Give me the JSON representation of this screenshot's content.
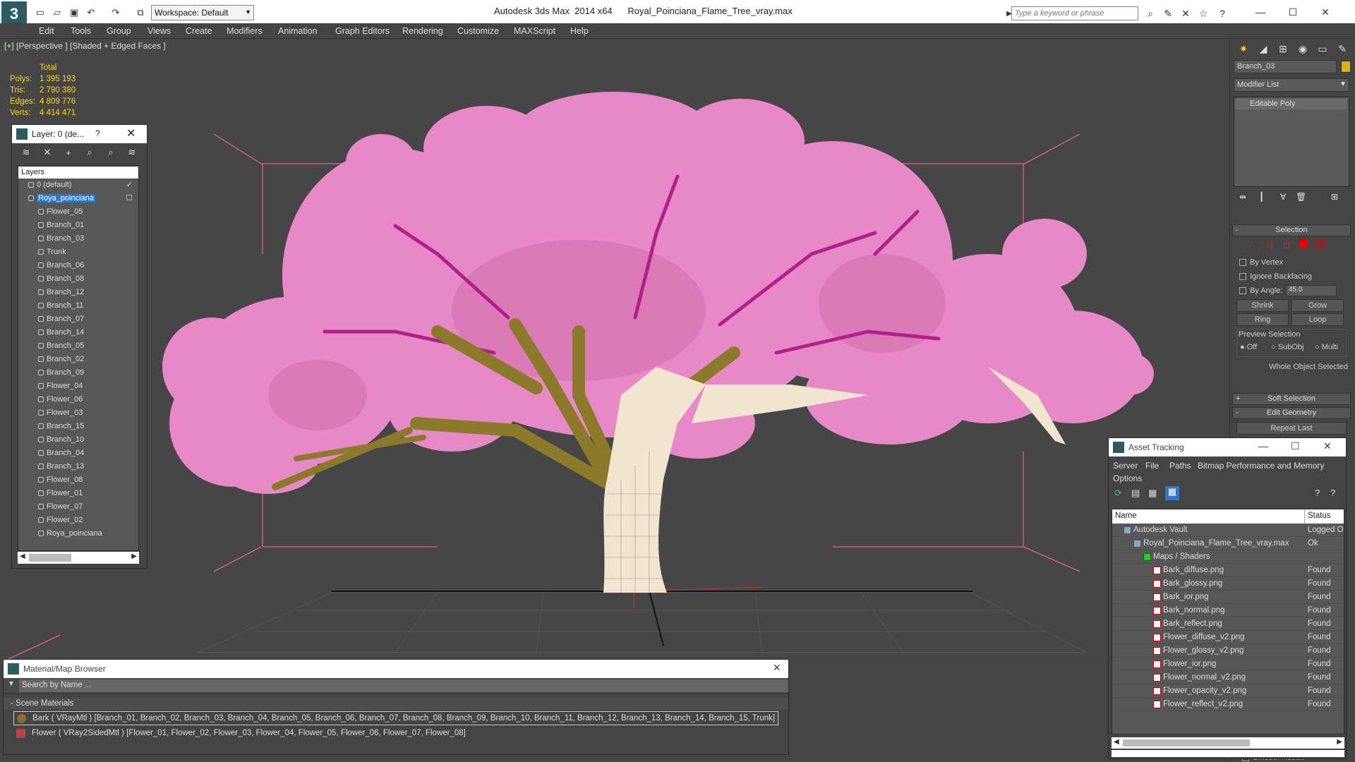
{
  "app": {
    "title": "Autodesk 3ds Max  2014 x64",
    "file": "Royal_Poinciana_Flame_Tree_vray.max",
    "workspace": "Workspace: Default",
    "search_placeholder": "Type a keyword or phrase"
  },
  "menu": [
    "Edit",
    "Tools",
    "Group",
    "Views",
    "Create",
    "Modifiers",
    "Animation",
    "Graph Editors",
    "Rendering",
    "Customize",
    "MAXScript",
    "Help"
  ],
  "viewport": {
    "label": "[+] [Perspective ] [Shaded + Edged Faces ]",
    "stats": {
      "header": "Total",
      "rows": [
        {
          "label": "Polys:",
          "value": "1 395 193"
        },
        {
          "label": "Tris:",
          "value": "2 790 380"
        },
        {
          "label": "Edges:",
          "value": "4 809 776"
        },
        {
          "label": "Verts:",
          "value": "4 414 471"
        }
      ]
    }
  },
  "layer_panel": {
    "title": "Layer: 0 (de...",
    "help": "?",
    "column": "Layers",
    "items": [
      "0 (default)",
      "Roya_poinciana",
      "Flower_05",
      "Branch_01",
      "Branch_03",
      "Trunk",
      "Branch_06",
      "Branch_08",
      "Branch_12",
      "Branch_11",
      "Branch_07",
      "Branch_14",
      "Branch_05",
      "Branch_02",
      "Branch_09",
      "Flower_04",
      "Flower_06",
      "Flower_03",
      "Branch_15",
      "Branch_10",
      "Branch_04",
      "Branch_13",
      "Flower_08",
      "Flower_01",
      "Flower_07",
      "Flower_02",
      "Roya_poinciana"
    ]
  },
  "command_panel": {
    "object_name": "Branch_03",
    "modifier_list": "Modifier List",
    "stack_item": "Editable Poly",
    "selection_title": "Selection",
    "by_vertex": "By Vertex",
    "ignore_backfacing": "Ignore Backfacing",
    "by_angle": "By Angle:",
    "angle_value": "45.0",
    "shrink": "Shrink",
    "grow": "Grow",
    "ring": "Ring",
    "loop": "Loop",
    "preview_selection": "Preview Selection",
    "preview_off": "Off",
    "preview_subobj": "SubObj",
    "preview_multi": "Multi",
    "whole_object": "Whole Object Selected",
    "soft_selection": "Soft Selection",
    "edit_geometry": "Edit Geometry",
    "repeat_last": "Repeat Last",
    "smooth_result": "Smooth Result"
  },
  "asset_tracking": {
    "title": "Asset Tracking",
    "menu": [
      "Server",
      "File",
      "Paths",
      "Bitmap Performance and Memory"
    ],
    "options": "Options",
    "columns": {
      "name": "Name",
      "status": "Status"
    },
    "rows": [
      {
        "name": "Autodesk Vault",
        "status": "Logged O",
        "indent": 0
      },
      {
        "name": "Royal_Poinciana_Flame_Tree_vray.max",
        "status": "Ok",
        "indent": 1
      },
      {
        "name": "Maps / Shaders",
        "status": "",
        "indent": 2
      },
      {
        "name": "Bark_diffuse.png",
        "status": "Found",
        "indent": 3
      },
      {
        "name": "Bark_glossy.png",
        "status": "Found",
        "indent": 3
      },
      {
        "name": "Bark_ior.png",
        "status": "Found",
        "indent": 3
      },
      {
        "name": "Bark_normal.png",
        "status": "Found",
        "indent": 3
      },
      {
        "name": "Bark_reflect.png",
        "status": "Found",
        "indent": 3
      },
      {
        "name": "Flower_diffuse_v2.png",
        "status": "Found",
        "indent": 3
      },
      {
        "name": "Flower_glossy_v2.png",
        "status": "Found",
        "indent": 3
      },
      {
        "name": "Flower_ior.png",
        "status": "Found",
        "indent": 3
      },
      {
        "name": "Flower_normal_v2.png",
        "status": "Found",
        "indent": 3
      },
      {
        "name": "Flower_opacity_v2.png",
        "status": "Found",
        "indent": 3
      },
      {
        "name": "Flower_reflect_v2.png",
        "status": "Found",
        "indent": 3
      }
    ]
  },
  "material_browser": {
    "title": "Material/Map Browser",
    "search_placeholder": "Search by Name ...",
    "group": "- Scene Materials",
    "materials": [
      {
        "text": "Bark  ( VRayMtl )  [Branch_01, Branch_02, Branch_03, Branch_04, Branch_05, Branch_06, Branch_07, Branch_08, Branch_09, Branch_10, Branch_11, Branch_12, Branch_13, Branch_14, Branch_15, Trunk]",
        "color": "#8a6a3a"
      },
      {
        "text": "Flower  ( VRay2SidedMtl )  [Flower_01, Flower_02, Flower_03, Flower_04, Flower_05, Flower_06, Flower_07, Flower_08]",
        "color": "#c04040"
      }
    ]
  },
  "colors": {
    "foliage": "#e889c7",
    "bark": "#8a7a2a",
    "wire": "#f0e6d0",
    "bounds": "#e06090",
    "stats": "#ffd700"
  }
}
